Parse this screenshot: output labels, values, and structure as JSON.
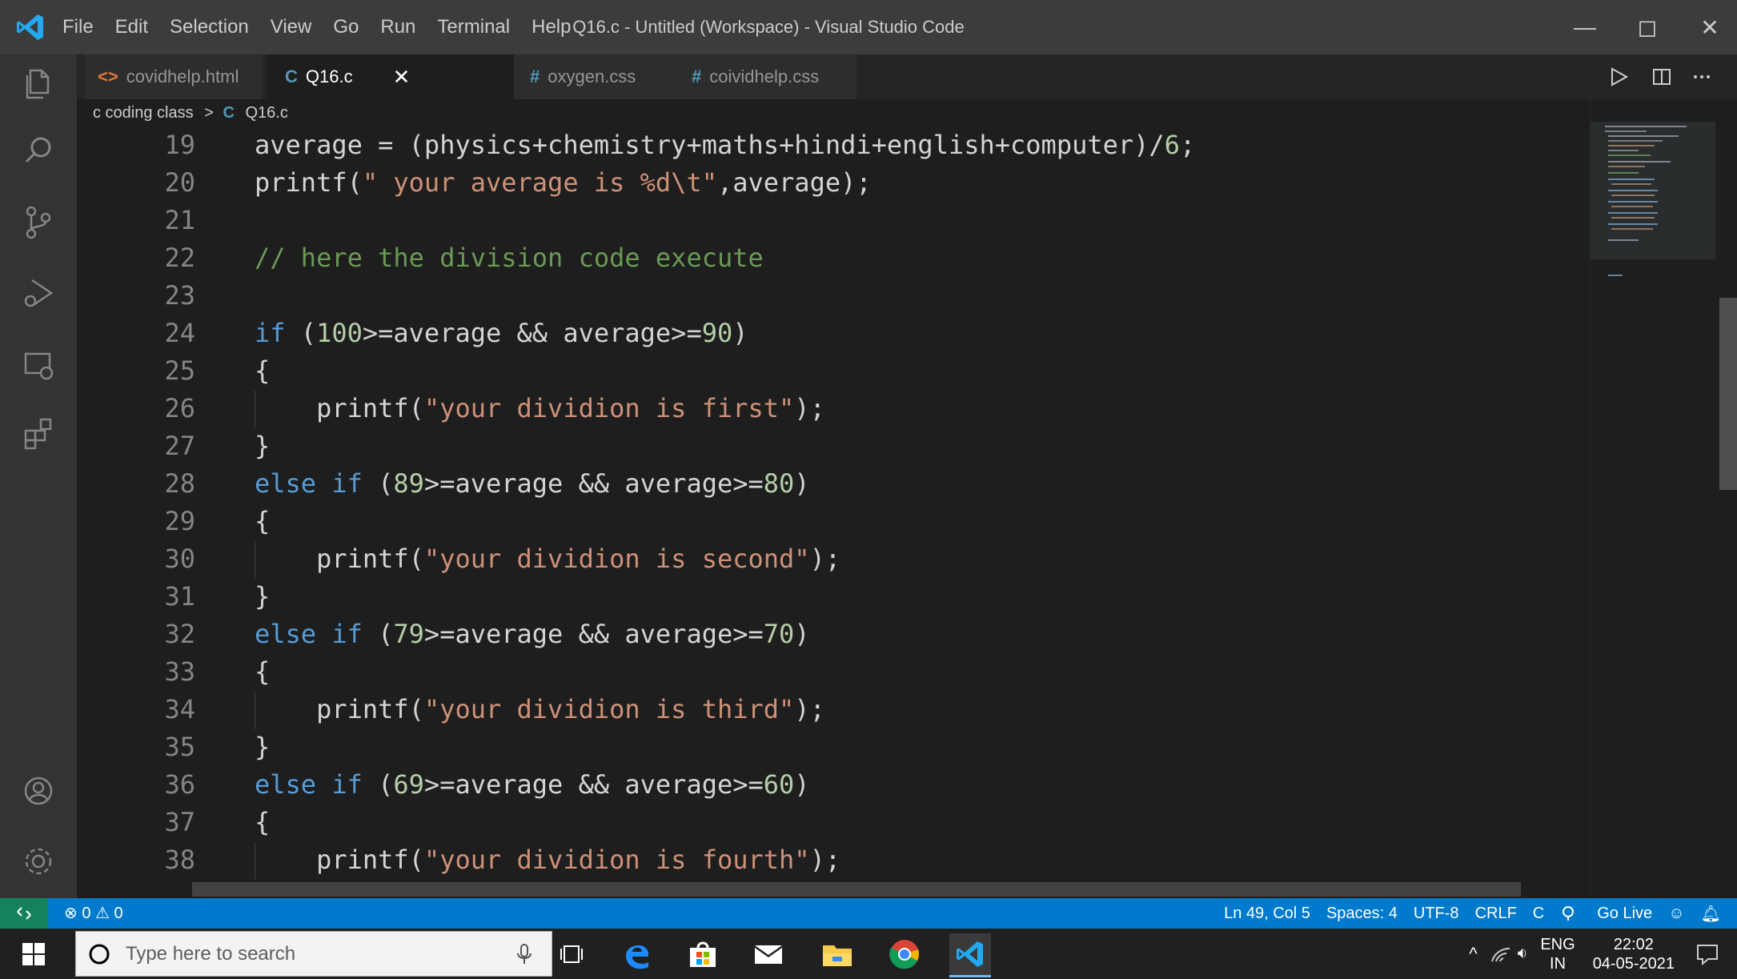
{
  "window": {
    "title": "Q16.c - Untitled (Workspace) - Visual Studio Code",
    "minimize": "—",
    "maximize": "◻",
    "close": "✕"
  },
  "menu": [
    "File",
    "Edit",
    "Selection",
    "View",
    "Go",
    "Run",
    "Terminal",
    "Help"
  ],
  "tabs": [
    {
      "icon": "<>",
      "label": "covidhelp.html",
      "icon_color": "#e37933"
    },
    {
      "icon": "C",
      "label": "Q16.c",
      "icon_color": "#519aba",
      "close": "✕"
    },
    {
      "icon": "#",
      "label": "oxygen.css",
      "icon_color": "#519aba"
    },
    {
      "icon": "#",
      "label": "coividhelp.css",
      "icon_color": "#519aba"
    }
  ],
  "breadcrumb": {
    "folder": "c coding class",
    "sep": ">",
    "lang_icon": "C",
    "file": "Q16.c"
  },
  "editor_lines": [
    {
      "n": "19",
      "tokens": [
        {
          "t": "average = (physics+chemistry+maths+hindi+english+computer)/",
          "c": ""
        },
        {
          "t": "6",
          "c": "num"
        },
        {
          "t": ";",
          "c": ""
        }
      ]
    },
    {
      "n": "20",
      "tokens": [
        {
          "t": "printf(",
          "c": ""
        },
        {
          "t": "\" your average is %d\\t\"",
          "c": "str"
        },
        {
          "t": ",average);",
          "c": ""
        }
      ]
    },
    {
      "n": "21",
      "tokens": []
    },
    {
      "n": "22",
      "tokens": [
        {
          "t": "// here the division code execute",
          "c": "cmt"
        }
      ]
    },
    {
      "n": "23",
      "tokens": []
    },
    {
      "n": "24",
      "tokens": [
        {
          "t": "if",
          "c": "kw"
        },
        {
          "t": " (",
          "c": ""
        },
        {
          "t": "100",
          "c": "num"
        },
        {
          "t": ">=average && average>=",
          "c": ""
        },
        {
          "t": "90",
          "c": "num"
        },
        {
          "t": ")",
          "c": ""
        }
      ]
    },
    {
      "n": "25",
      "tokens": [
        {
          "t": "{",
          "c": ""
        }
      ]
    },
    {
      "n": "26",
      "tokens": [
        {
          "t": "    printf(",
          "c": ""
        },
        {
          "t": "\"your dividion is first\"",
          "c": "str"
        },
        {
          "t": ");",
          "c": ""
        }
      ]
    },
    {
      "n": "27",
      "tokens": [
        {
          "t": "}",
          "c": ""
        }
      ]
    },
    {
      "n": "28",
      "tokens": [
        {
          "t": "else if",
          "c": "kw"
        },
        {
          "t": " (",
          "c": ""
        },
        {
          "t": "89",
          "c": "num"
        },
        {
          "t": ">=average && average>=",
          "c": ""
        },
        {
          "t": "80",
          "c": "num"
        },
        {
          "t": ")",
          "c": ""
        }
      ]
    },
    {
      "n": "29",
      "tokens": [
        {
          "t": "{",
          "c": ""
        }
      ]
    },
    {
      "n": "30",
      "tokens": [
        {
          "t": "    printf(",
          "c": ""
        },
        {
          "t": "\"your dividion is second\"",
          "c": "str"
        },
        {
          "t": ");",
          "c": ""
        }
      ]
    },
    {
      "n": "31",
      "tokens": [
        {
          "t": "}",
          "c": ""
        }
      ]
    },
    {
      "n": "32",
      "tokens": [
        {
          "t": "else if",
          "c": "kw"
        },
        {
          "t": " (",
          "c": ""
        },
        {
          "t": "79",
          "c": "num"
        },
        {
          "t": ">=average && average>=",
          "c": ""
        },
        {
          "t": "70",
          "c": "num"
        },
        {
          "t": ")",
          "c": ""
        }
      ]
    },
    {
      "n": "33",
      "tokens": [
        {
          "t": "{",
          "c": ""
        }
      ]
    },
    {
      "n": "34",
      "tokens": [
        {
          "t": "    printf(",
          "c": ""
        },
        {
          "t": "\"your dividion is third\"",
          "c": "str"
        },
        {
          "t": ");",
          "c": ""
        }
      ]
    },
    {
      "n": "35",
      "tokens": [
        {
          "t": "}",
          "c": ""
        }
      ]
    },
    {
      "n": "36",
      "tokens": [
        {
          "t": "else if",
          "c": "kw"
        },
        {
          "t": " (",
          "c": ""
        },
        {
          "t": "69",
          "c": "num"
        },
        {
          "t": ">=average && average>=",
          "c": ""
        },
        {
          "t": "60",
          "c": "num"
        },
        {
          "t": ")",
          "c": ""
        }
      ]
    },
    {
      "n": "37",
      "tokens": [
        {
          "t": "{",
          "c": ""
        }
      ]
    },
    {
      "n": "38",
      "tokens": [
        {
          "t": "    printf(",
          "c": ""
        },
        {
          "t": "\"your dividion is fourth\"",
          "c": "str"
        },
        {
          "t": ");",
          "c": ""
        }
      ]
    }
  ],
  "statusbar": {
    "remote_icon": "remote-icon",
    "problems": "⊗ 0 ⚠ 0",
    "position": "Ln 49, Col 5",
    "spaces": "Spaces: 4",
    "encoding": "UTF-8",
    "eol": "CRLF",
    "language": "C",
    "golive": "Go Live"
  },
  "taskbar": {
    "search_placeholder": "Type here to search",
    "lang": "ENG",
    "region": "IN",
    "time": "22:02",
    "date": "04-05-2021"
  },
  "colors": {
    "accent": "#007acc",
    "keyword": "#569cd6",
    "string": "#ce9178",
    "number": "#b5cea8",
    "comment": "#6a9955"
  }
}
